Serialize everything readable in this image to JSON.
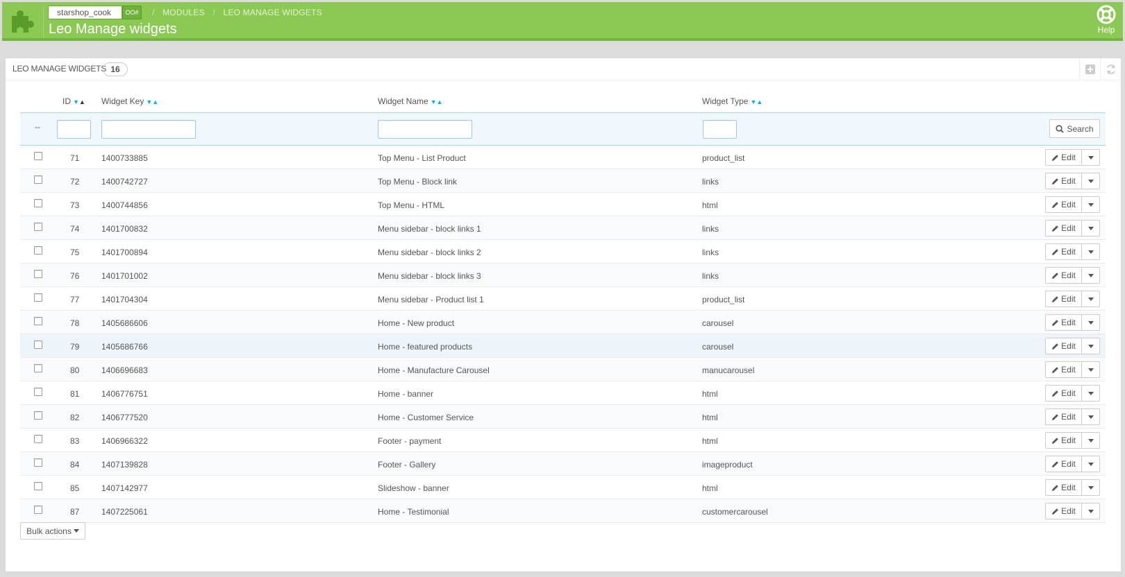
{
  "header": {
    "shop_name": "starshop_cook",
    "shop_button": "OO#",
    "breadcrumb": [
      "MODULES",
      "LEO MANAGE WIDGETS"
    ],
    "title": "Leo Manage widgets",
    "help_label": "Help",
    "bg_color": "#8bc954"
  },
  "panel": {
    "title": "LEO MANAGE WIDGETS",
    "count": "16"
  },
  "table": {
    "columns": [
      "ID",
      "Widget Key",
      "Widget Name",
      "Widget Type"
    ],
    "filter_dash": "--",
    "search_label": "Search",
    "edit_label": "Edit",
    "rows": [
      {
        "id": "71",
        "key": "1400733885",
        "name": "Top Menu - List Product",
        "type": "product_list"
      },
      {
        "id": "72",
        "key": "1400742727",
        "name": "Top Menu - Block link",
        "type": "links"
      },
      {
        "id": "73",
        "key": "1400744856",
        "name": "Top Menu - HTML",
        "type": "html"
      },
      {
        "id": "74",
        "key": "1401700832",
        "name": "Menu sidebar - block links 1",
        "type": "links"
      },
      {
        "id": "75",
        "key": "1401700894",
        "name": "Menu sidebar - block links 2",
        "type": "links"
      },
      {
        "id": "76",
        "key": "1401701002",
        "name": "Menu sidebar - block links 3",
        "type": "links"
      },
      {
        "id": "77",
        "key": "1401704304",
        "name": "Menu sidebar - Product list 1",
        "type": "product_list"
      },
      {
        "id": "78",
        "key": "1405686606",
        "name": "Home - New product",
        "type": "carousel"
      },
      {
        "id": "79",
        "key": "1405686766",
        "name": "Home - featured products",
        "type": "carousel"
      },
      {
        "id": "80",
        "key": "1406696683",
        "name": "Home - Manufacture Carousel",
        "type": "manucarousel"
      },
      {
        "id": "81",
        "key": "1406776751",
        "name": "Home - banner",
        "type": "html"
      },
      {
        "id": "82",
        "key": "1406777520",
        "name": "Home - Customer Service",
        "type": "html"
      },
      {
        "id": "83",
        "key": "1406966322",
        "name": "Footer - payment",
        "type": "html"
      },
      {
        "id": "84",
        "key": "1407139828",
        "name": "Footer - Gallery",
        "type": "imageproduct"
      },
      {
        "id": "85",
        "key": "1407142977",
        "name": "Slideshow - banner",
        "type": "html"
      },
      {
        "id": "87",
        "key": "1407225061",
        "name": "Home - Testimonial",
        "type": "customercarousel"
      }
    ]
  },
  "bulk_actions_label": "Bulk actions"
}
